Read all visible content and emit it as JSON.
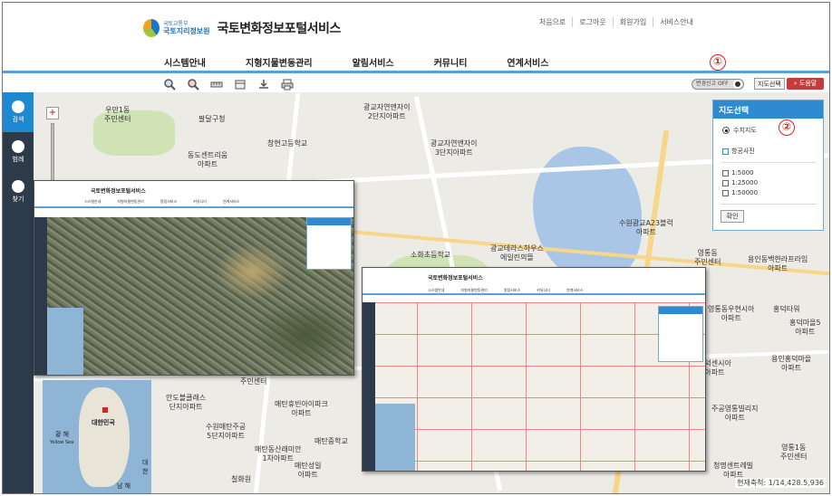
{
  "header": {
    "org_small": "국토교통부",
    "org_name": "국토지리정보원",
    "site_title": "국토변화정보포털서비스",
    "util_links": [
      "처음으로",
      "로그아웃",
      "회원가입",
      "서비스안내"
    ],
    "gnb": [
      "시스템안내",
      "지형지물변동관리",
      "알림서비스",
      "커뮤니티",
      "연계서비스"
    ]
  },
  "toolbar": {
    "tools": [
      "zoom-in-icon",
      "zoom-out-icon",
      "measure-distance-icon",
      "measure-area-icon",
      "download-icon",
      "print-icon"
    ],
    "toggle_label": "변경신고 OFF",
    "map_select_label": "지도선택",
    "help_label": "도움말",
    "annotation_1": "①",
    "annotation_2": "②"
  },
  "sidepanel": {
    "items": [
      "검색",
      "범례",
      "찾기"
    ]
  },
  "map_select_panel": {
    "title": "지도선택",
    "options": [
      "수치지도",
      "항공사진"
    ],
    "selected": "수치지도",
    "scales": [
      "1:5000",
      "1:25000",
      "1:50000"
    ],
    "confirm_label": "확인"
  },
  "map": {
    "labels": [
      {
        "text": "우만1동\n주민센터"
      },
      {
        "text": "팔달구청"
      },
      {
        "text": "동도센트리움\n아파트"
      },
      {
        "text": "창현고등학교"
      },
      {
        "text": "광교자연앤자이\n2단지아파트"
      },
      {
        "text": "광교자연앤자이\n3단지아파트"
      },
      {
        "text": "소화초등학교"
      },
      {
        "text": "광교테라스하우스\n에일린의뜰"
      },
      {
        "text": "수원광교A23블럭\n아파트"
      },
      {
        "text": "영통동\n주민센터"
      },
      {
        "text": "용인동백한라프라임\n아파트"
      },
      {
        "text": "영통동우현시아\n아파트"
      },
      {
        "text": "홍덕타워"
      },
      {
        "text": "홍덕마을5\n아파트"
      },
      {
        "text": "용인홍덕마을\n아파트"
      },
      {
        "text": "홍덕센시아\n아파트"
      },
      {
        "text": "주공영통빌리지\n아파트"
      },
      {
        "text": "영통1동\n주민센터"
      },
      {
        "text": "청명센트레빌\n아파트"
      },
      {
        "text": "안도블클래스\n단지아파트"
      },
      {
        "text": "매탄휴빈아이파크\n아파트"
      },
      {
        "text": "수원매탄주공\n5단지아파트"
      },
      {
        "text": "매탄중학교"
      },
      {
        "text": "매탄동산래미안\n1차아파트"
      },
      {
        "text": "매탄성일\n아파트"
      },
      {
        "text": "칠화원"
      },
      {
        "text": "2동\n주민센터"
      }
    ],
    "scale_text": "현재축척: 1/14,428.5,936",
    "inset": {
      "korea": "대한민국",
      "yellow_sea": "황 해",
      "yellow_sea_en": "Yellow Sea",
      "south_sea": "남 해",
      "east_label": "대 한"
    }
  },
  "mini_aerial": {
    "title": "국토변화정보포털서비스",
    "nav": [
      "시스템안내",
      "지형지물변동관리",
      "알림서비스",
      "커뮤니티",
      "연계서비스"
    ]
  },
  "mini_grid": {
    "title": "국토변화정보포털서비스",
    "nav": [
      "시스템안내",
      "지형지물변동관리",
      "알림서비스",
      "커뮤니티",
      "연계서비스"
    ]
  },
  "colors": {
    "accent": "#2f8acf",
    "header_line": "#5aa0d8",
    "side": "#2c3a4a",
    "help": "#c43b3b",
    "annotation": "#dd2222"
  }
}
